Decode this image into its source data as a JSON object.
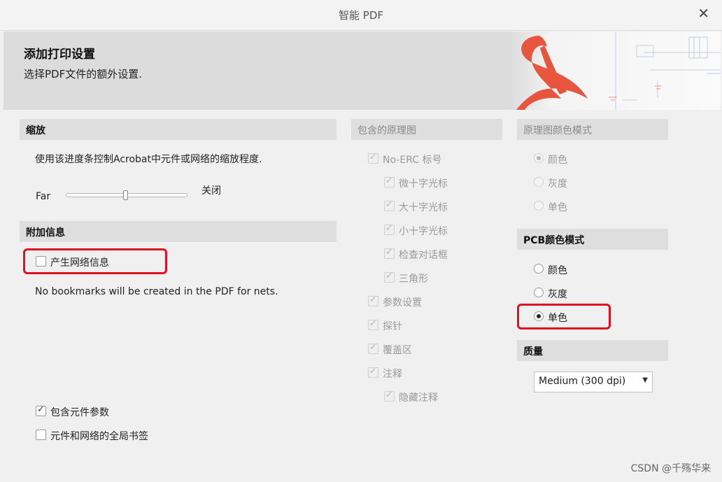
{
  "window": {
    "title": "智能 PDF",
    "close_glyph": "✕"
  },
  "header": {
    "title": "添加打印设置",
    "subtitle": "选择PDF文件的额外设置."
  },
  "zoom": {
    "heading": "缩放",
    "description": "使用该进度条控制Acrobat中元件或网络的缩放程度.",
    "left_label": "Far",
    "right_label": "关闭",
    "level_fraction": 0.5
  },
  "extra_info": {
    "heading": "附加信息",
    "net_info_label": "产生网络信息",
    "net_info_checked": false,
    "note": "No bookmarks will be created in the PDF for nets.",
    "include_params_label": "包含元件参数",
    "include_params_checked": true,
    "global_bookmarks_label": "元件和网络的全局书签",
    "global_bookmarks_checked": false
  },
  "schematics": {
    "heading": "包含的原理图",
    "items": [
      {
        "label": "No-ERC 标号",
        "checked": true
      },
      {
        "label": "微十字光标",
        "checked": true
      },
      {
        "label": "大十字光标",
        "checked": true
      },
      {
        "label": "小十字光标",
        "checked": true
      },
      {
        "label": "检查对话框",
        "checked": true
      },
      {
        "label": "三角形",
        "checked": true
      },
      {
        "label": "参数设置",
        "checked": true
      },
      {
        "label": "探针",
        "checked": true
      },
      {
        "label": "覆盖区",
        "checked": true
      },
      {
        "label": "注释",
        "checked": true
      },
      {
        "label": "隐藏注释",
        "checked": true
      }
    ]
  },
  "schematic_color": {
    "heading": "原理图颜色模式",
    "options": [
      "颜色",
      "灰度",
      "单色"
    ],
    "selected": "颜色"
  },
  "pcb_color": {
    "heading": "PCB颜色模式",
    "options": [
      "颜色",
      "灰度",
      "单色"
    ],
    "selected": "单色"
  },
  "quality": {
    "heading": "质量",
    "value": "Medium (300 dpi)"
  },
  "watermark": "CSDN @千殇华来",
  "colors": {
    "highlight": "#e0101e",
    "acrobat_red": "#e8553e"
  }
}
